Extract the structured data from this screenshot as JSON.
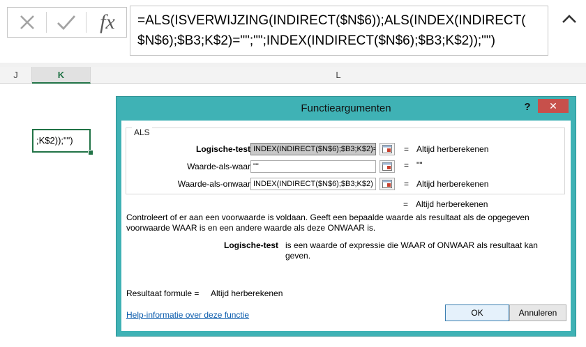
{
  "formula_bar": {
    "cancel_icon": "x-icon",
    "enter_icon": "check-icon",
    "fx_label": "fx",
    "formula_line1": "=ALS(ISVERWIJZING(INDIRECT($N$6));ALS(INDEX(INDIRECT(",
    "formula_line2": "$N$6);$B3;K$2)=\"\";\"\";INDEX(INDIRECT($N$6);$B3;K$2));\"\")"
  },
  "columns": {
    "j": "J",
    "k": "K",
    "l": "L"
  },
  "active_cell": {
    "text": ";K$2));\"\")"
  },
  "dialog": {
    "title": "Functieargumenten",
    "help": "?",
    "close": "✕",
    "function_name": "ALS",
    "args": [
      {
        "label": "Logische-test",
        "value": "INDEX(INDIRECT($N$6);$B3;K$2)=",
        "eq": "=",
        "result": "Altijd herberekenen"
      },
      {
        "label": "Waarde-als-waar",
        "value": "\"\"",
        "eq": "=",
        "result": "\"\""
      },
      {
        "label": "Waarde-als-onwaar",
        "value": "INDEX(INDIRECT($N$6);$B3;K$2)",
        "eq": "=",
        "result": "Altijd herberekenen"
      }
    ],
    "overall_eq": "=",
    "overall_result": "Altijd herberekenen",
    "description": "Controleert of er aan een voorwaarde is voldaan. Geeft een bepaalde waarde als resultaat als de opgegeven voorwaarde WAAR is en een andere waarde als deze ONWAAR is.",
    "param_name": "Logische-test",
    "param_desc": "is een waarde of expressie die WAAR of ONWAAR als resultaat kan geven.",
    "result_label": "Resultaat formule =",
    "result_value": "Altijd herberekenen",
    "help_link": "Help-informatie over deze functie",
    "ok": "OK",
    "cancel": "Annuleren"
  },
  "colors": {
    "dialog_frame": "#3fb2b5",
    "selection": "#217346",
    "close_button": "#c7504b",
    "link": "#0b5cad"
  }
}
